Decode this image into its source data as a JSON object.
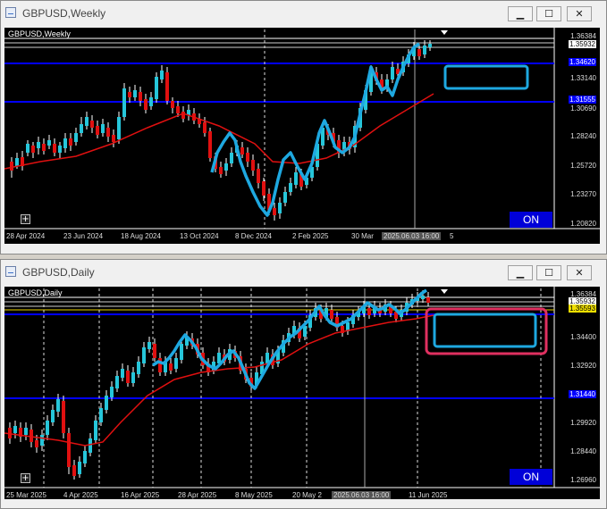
{
  "top_window": {
    "title": "GBPUSD,Weekly",
    "chart_label": "GBPUSD,Weekly",
    "buttons": {
      "min": "▁",
      "max": "☐",
      "close": "✕"
    },
    "on_label": "ON",
    "plus_label": "+",
    "price_labels": [
      "1.36384",
      "1.35932",
      "1.34620",
      "1.33140",
      "1.31555",
      "1.30690",
      "1.28240",
      "1.25720",
      "1.23270",
      "1.20820"
    ],
    "date_labels": [
      "28 Apr 2024",
      "23 Jun 2024",
      "18 Aug 2024",
      "13 Oct 2024",
      "8 Dec 2024",
      "2 Feb 2025",
      "30 Mar",
      "2025.06.03 16:00",
      "5"
    ]
  },
  "bottom_window": {
    "title": "GBPUSD,Daily",
    "chart_label": "GBPUSD,Daily",
    "buttons": {
      "min": "▁",
      "max": "☐",
      "close": "✕"
    },
    "on_label": "ON",
    "plus_label": "+",
    "price_labels": [
      "1.36384",
      "1.35932",
      "1.35593",
      "1.34400",
      "1.32920",
      "1.31440",
      "1.29920",
      "1.28440",
      "1.26960"
    ],
    "date_labels": [
      "25 Mar 2025",
      "4 Apr 2025",
      "16 Apr 2025",
      "28 Apr 2025",
      "8 May 2025",
      "20 May 2",
      "2025.06.03 16:00",
      "11 Jun 2025"
    ]
  },
  "colors": {
    "bull": "#26c6da",
    "bear": "#e01010",
    "ma": "#e01010",
    "level": "#0000ff",
    "drawing": "#1ea8e0",
    "highlight": "#e03060"
  }
}
